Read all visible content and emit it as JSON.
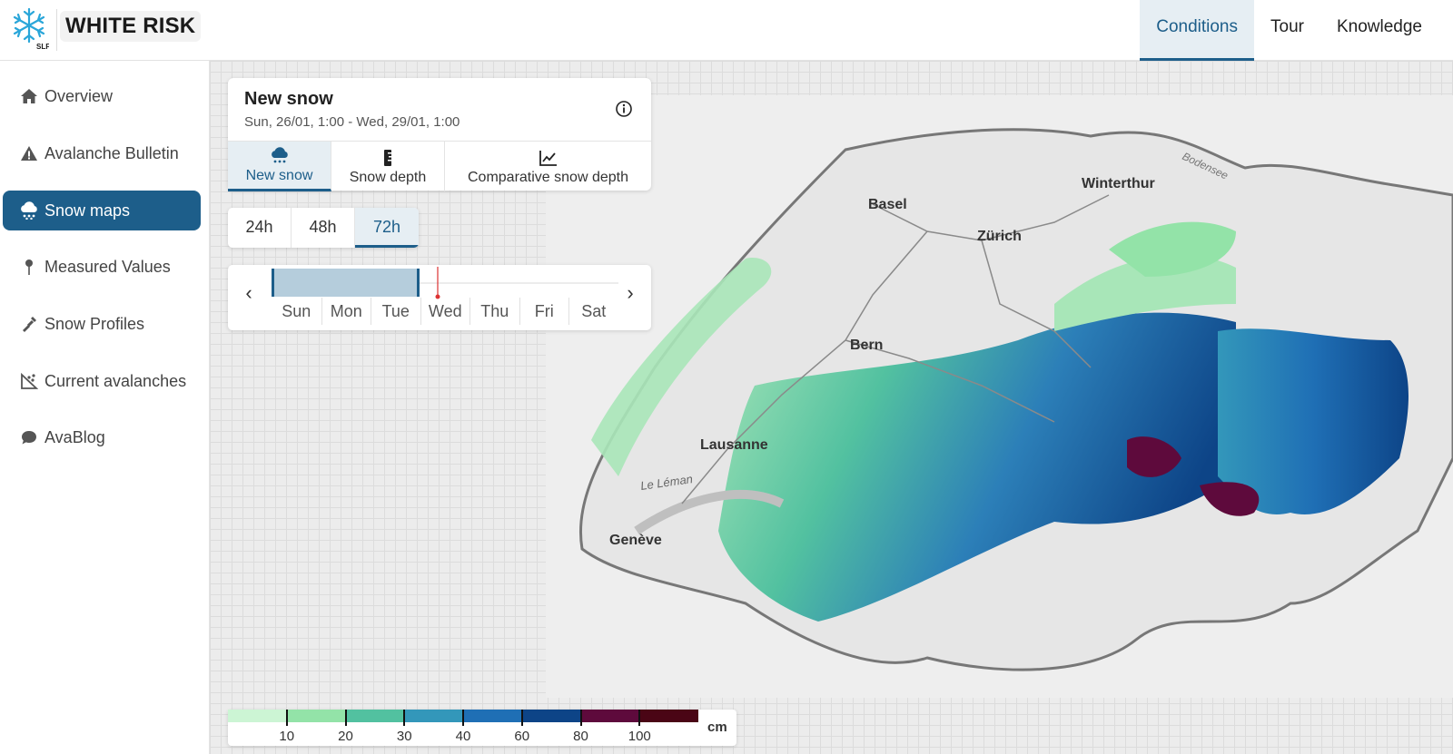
{
  "header": {
    "brand": "WHITE RISK",
    "logo_text": "SLF",
    "nav": [
      {
        "label": "Conditions",
        "active": true
      },
      {
        "label": "Tour",
        "active": false
      },
      {
        "label": "Knowledge",
        "active": false
      }
    ]
  },
  "sidebar": {
    "items": [
      {
        "label": "Overview",
        "icon": "home-icon",
        "active": false
      },
      {
        "label": "Avalanche Bulletin",
        "icon": "warning-icon",
        "active": false
      },
      {
        "label": "Snow maps",
        "icon": "snow-cloud-icon",
        "active": true
      },
      {
        "label": "Measured Values",
        "icon": "pin-icon",
        "active": false
      },
      {
        "label": "Snow Profiles",
        "icon": "shovel-icon",
        "active": false
      },
      {
        "label": "Current avalanches",
        "icon": "avalanche-icon",
        "active": false
      },
      {
        "label": "AvaBlog",
        "icon": "chat-bubble-icon",
        "active": false
      }
    ]
  },
  "panel": {
    "title": "New snow",
    "subtitle": "Sun, 26/01, 1:00 - Wed, 29/01, 1:00",
    "tabs": [
      {
        "label": "New snow",
        "icon": "snow-cloud-icon",
        "active": true
      },
      {
        "label": "Snow depth",
        "icon": "ruler-icon",
        "active": false
      },
      {
        "label": "Comparative snow depth",
        "icon": "line-chart-icon",
        "active": false
      }
    ]
  },
  "ranges": [
    {
      "label": "24h",
      "active": false
    },
    {
      "label": "48h",
      "active": false
    },
    {
      "label": "72h",
      "active": true
    }
  ],
  "timeline": {
    "days": [
      "Sun",
      "Mon",
      "Tue",
      "Wed",
      "Thu",
      "Fri",
      "Sat"
    ],
    "prev": "‹",
    "next": "›"
  },
  "map": {
    "cities": [
      "Basel",
      "Winterthur",
      "Zürich",
      "Bern",
      "Lausanne",
      "Genève"
    ],
    "lake_label": "Le Léman",
    "bodensee_label": "Bodensee"
  },
  "legend": {
    "colors": [
      "#ccf5d4",
      "#93e3a8",
      "#52c1a0",
      "#3397ba",
      "#1f6fb5",
      "#0d4487",
      "#5e0a3c",
      "#4a0515"
    ],
    "labels": [
      "10",
      "20",
      "30",
      "40",
      "60",
      "80",
      "100"
    ],
    "unit": "cm"
  },
  "colors": {
    "accent": "#1d5e8a",
    "active_bg": "#e6eef3",
    "timeline_marker": "#d33"
  }
}
